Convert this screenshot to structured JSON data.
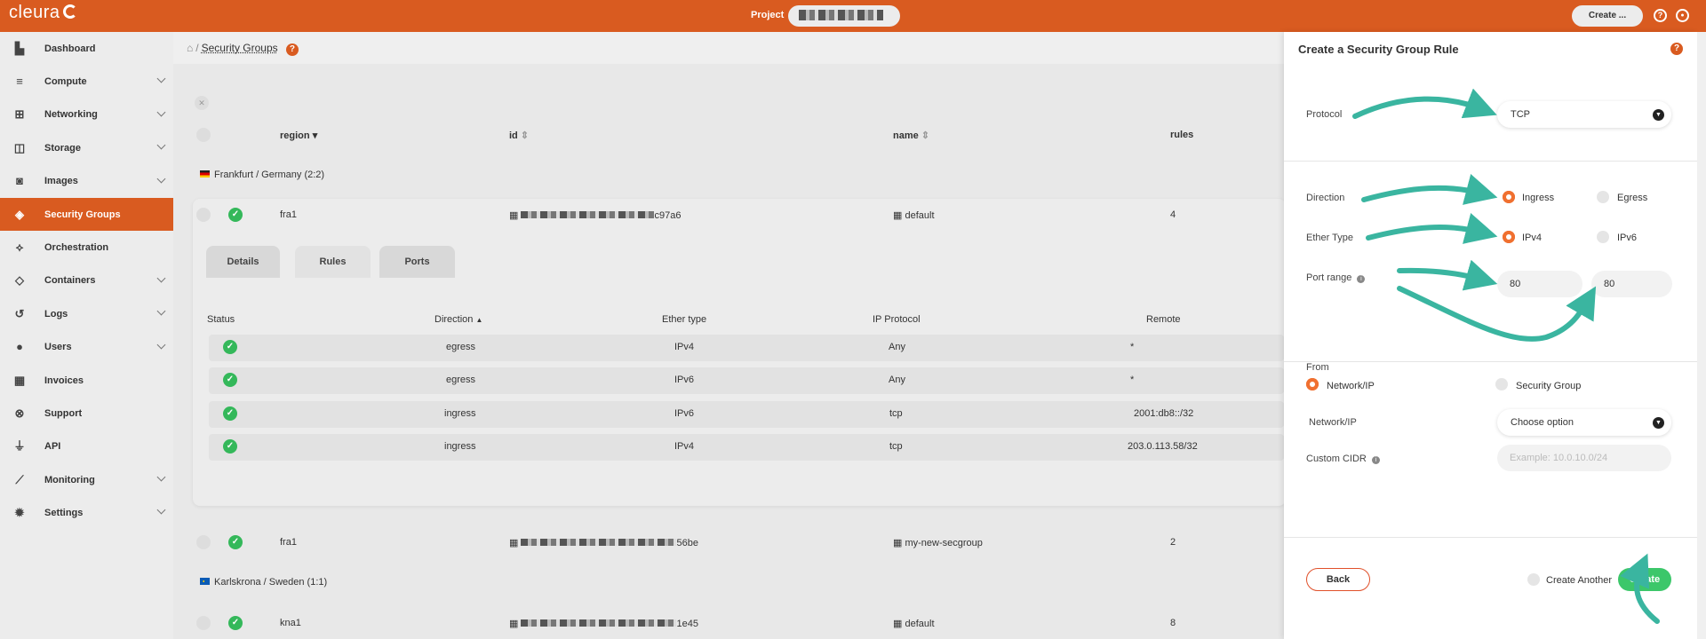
{
  "topbar": {
    "logo": "cleura",
    "project_label": "Project",
    "create_label": "Create ...",
    "help_glyph": "?",
    "user_glyph": "●"
  },
  "sidebar": {
    "items": [
      {
        "label": "Dashboard",
        "icon": "chart-icon",
        "glyph": "▙"
      },
      {
        "label": "Compute",
        "icon": "server-icon",
        "glyph": "≡"
      },
      {
        "label": "Networking",
        "icon": "network-icon",
        "glyph": "⊞"
      },
      {
        "label": "Storage",
        "icon": "database-icon",
        "glyph": "◫"
      },
      {
        "label": "Images",
        "icon": "camera-icon",
        "glyph": "◙"
      },
      {
        "label": "Security Groups",
        "icon": "shield-icon",
        "glyph": "◈"
      },
      {
        "label": "Orchestration",
        "icon": "orchestration-icon",
        "glyph": "⟡"
      },
      {
        "label": "Containers",
        "icon": "cube-icon",
        "glyph": "◇"
      },
      {
        "label": "Logs",
        "icon": "history-icon",
        "glyph": "↺"
      },
      {
        "label": "Users",
        "icon": "user-icon",
        "glyph": "●"
      },
      {
        "label": "Invoices",
        "icon": "calculator-icon",
        "glyph": "▦"
      },
      {
        "label": "Support",
        "icon": "lifebuoy-icon",
        "glyph": "⊗"
      },
      {
        "label": "API",
        "icon": "plug-icon",
        "glyph": "⏚"
      },
      {
        "label": "Monitoring",
        "icon": "line-chart-icon",
        "glyph": "⟋"
      },
      {
        "label": "Settings",
        "icon": "gear-icon",
        "glyph": "✹"
      }
    ]
  },
  "breadcrumb": {
    "home_glyph": "⌂",
    "sep": "/",
    "current": "Security Groups",
    "help_glyph": "?"
  },
  "table": {
    "headers": {
      "region": "region",
      "id": "id",
      "name": "name",
      "rules": "rules"
    },
    "group1": "Frankfurt / Germany  (2:2)",
    "group2": "Karlskrona / Sweden  (1:1)",
    "rows": [
      {
        "region": "fra1",
        "id_suffix": "c97a6",
        "name": "default",
        "rules": "4"
      },
      {
        "region": "fra1",
        "id_suffix": "56be",
        "name": "my-new-secgroup",
        "rules": "2"
      },
      {
        "region": "kna1",
        "id_suffix": "1e45",
        "name": "default",
        "rules": "8"
      }
    ]
  },
  "detail": {
    "tabs": [
      "Details",
      "Rules",
      "Ports"
    ],
    "headers": {
      "status": "Status",
      "direction": "Direction",
      "ether": "Ether type",
      "protocol": "IP Protocol",
      "remote": "Remote"
    },
    "rules": [
      {
        "direction": "egress",
        "ether": "IPv4",
        "protocol": "Any",
        "remote": "*"
      },
      {
        "direction": "egress",
        "ether": "IPv6",
        "protocol": "Any",
        "remote": "*"
      },
      {
        "direction": "ingress",
        "ether": "IPv6",
        "protocol": "tcp",
        "remote": "2001:db8::/32"
      },
      {
        "direction": "ingress",
        "ether": "IPv4",
        "protocol": "tcp",
        "remote": "203.0.113.58/32"
      }
    ]
  },
  "panel": {
    "title": "Create a Security Group Rule",
    "help_glyph": "?",
    "protocol_label": "Protocol",
    "protocol_value": "TCP",
    "direction_label": "Direction",
    "direction_options": [
      "Ingress",
      "Egress"
    ],
    "ether_label": "Ether Type",
    "ether_options": [
      "IPv4",
      "IPv6"
    ],
    "port_label": "Port range",
    "port_from": "80",
    "port_to": "80",
    "from_label": "From",
    "from_options": [
      "Network/IP",
      "Security Group"
    ],
    "network_label": "Network/IP",
    "network_value": "Choose option",
    "cidr_label": "Custom CIDR",
    "cidr_placeholder": "Example: 10.0.10.0/24",
    "back_label": "Back",
    "create_another_label": "Create Another",
    "create_label": "Create",
    "info_glyph": "i",
    "caret_glyph": "▼"
  },
  "colors": {
    "brand": "#d95b20",
    "success": "#34b85a",
    "create_button": "#3cc76a",
    "annotation_arrows": "#3ab5a0"
  }
}
